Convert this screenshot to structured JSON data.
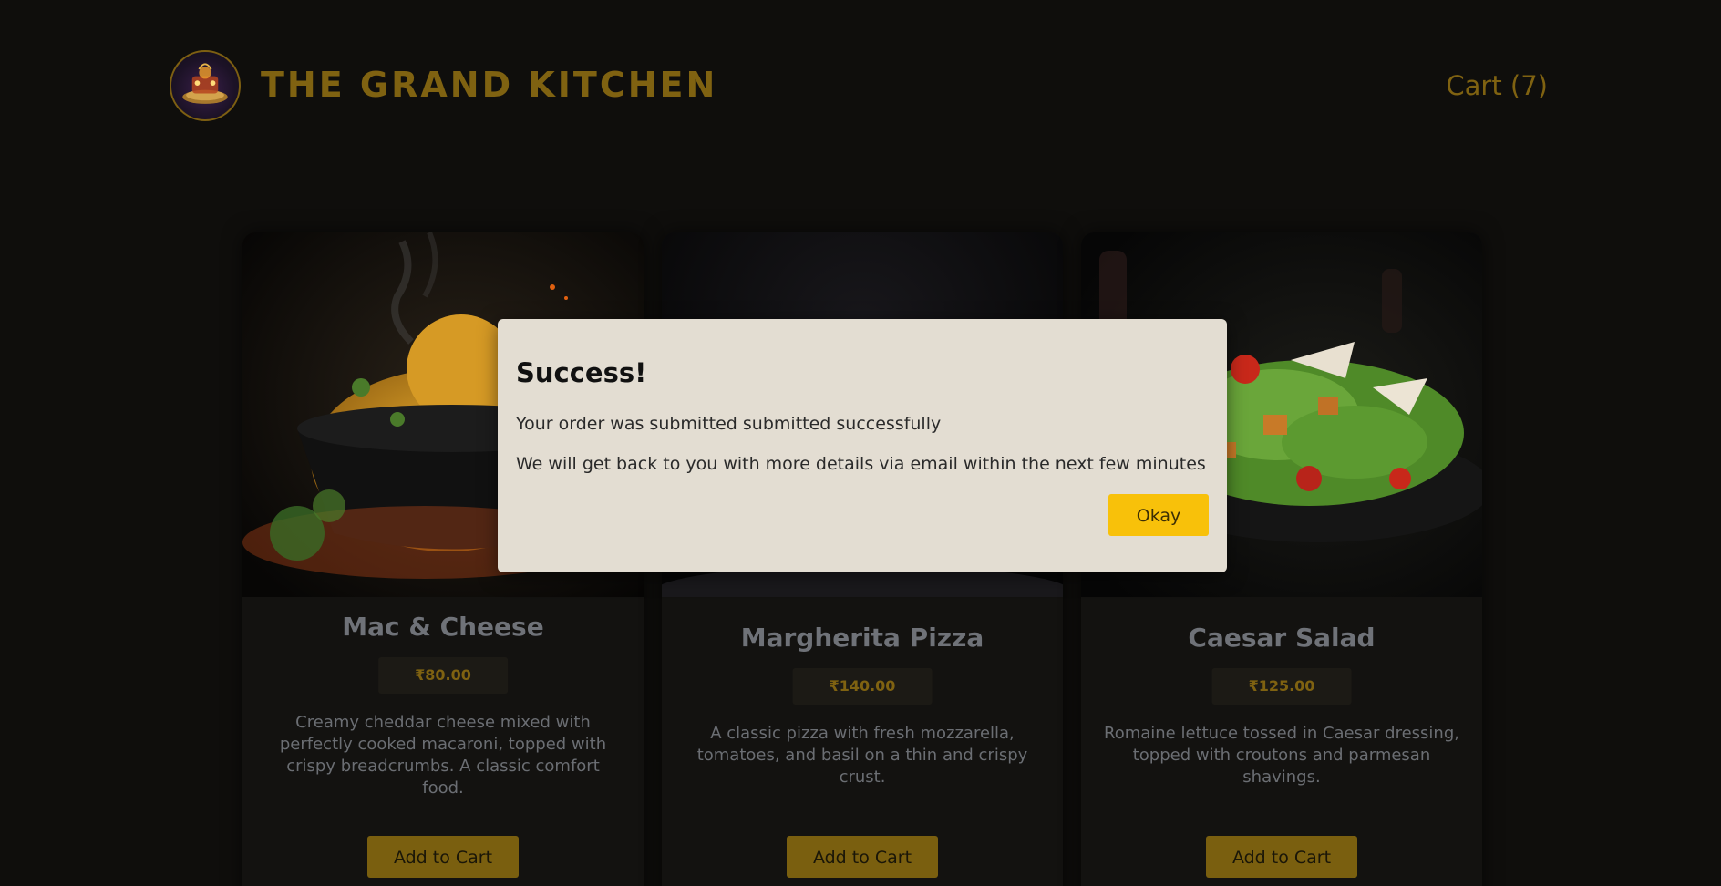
{
  "header": {
    "brand_title": "THE GRAND KITCHEN",
    "cart_label": "Cart (7)",
    "logo_icon": "restaurant-logo-icon"
  },
  "menu": {
    "items": [
      {
        "title": "Mac & Cheese",
        "price": "₹80.00",
        "description": "Creamy cheddar cheese mixed with perfectly cooked macaroni, topped with crispy breadcrumbs. A classic comfort food.",
        "button": "Add to Cart",
        "image": "mac-and-cheese-photo"
      },
      {
        "title": "Margherita Pizza",
        "price": "₹140.00",
        "description": "A classic pizza with fresh mozzarella, tomatoes, and basil on a thin and crispy crust.",
        "button": "Add to Cart",
        "image": "margherita-pizza-photo"
      },
      {
        "title": "Caesar Salad",
        "price": "₹125.00",
        "description": "Romaine lettuce tossed in Caesar dressing, topped with croutons and parmesan shavings.",
        "button": "Add to Cart",
        "image": "caesar-salad-photo"
      }
    ]
  },
  "modal": {
    "title": "Success!",
    "line1": "Your order was submitted submitted successfully",
    "line2": "We will get back to you with more details via email within the next few minutes",
    "button": "Okay"
  },
  "colors": {
    "background": "#0f0e0c",
    "brand_gold": "#7f6211",
    "modal_bg": "#e3ddd2",
    "okay_button": "#f8c10a"
  }
}
